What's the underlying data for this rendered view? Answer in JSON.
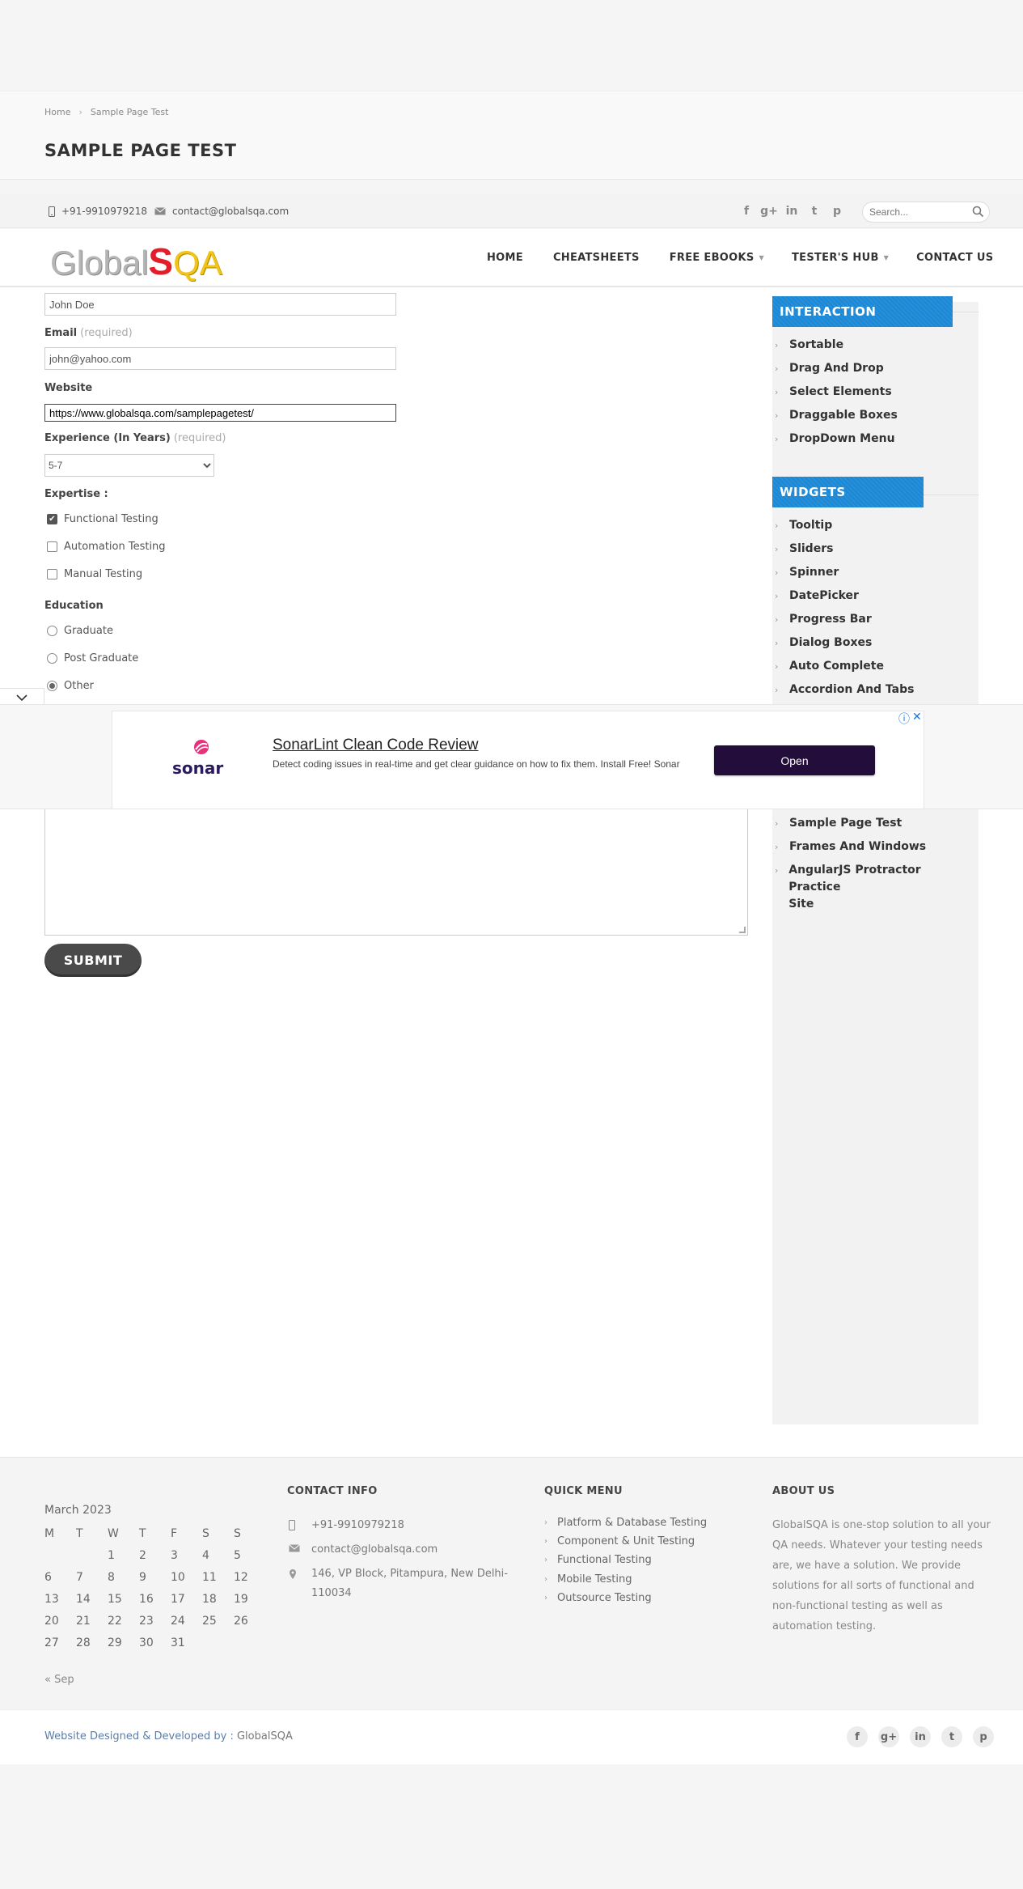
{
  "breadcrumb": {
    "home": "Home",
    "current": "Sample Page Test"
  },
  "page_title": "SAMPLE PAGE TEST",
  "topbar": {
    "phone": "+91-9910979218",
    "email": "contact@globalsqa.com",
    "social": [
      "f",
      "g+",
      "in",
      "t",
      "p"
    ],
    "search_placeholder": "Search..."
  },
  "logo": {
    "part1": "Global",
    "part2": "S",
    "part3": "QA"
  },
  "nav": [
    {
      "label": "HOME",
      "dropdown": false
    },
    {
      "label": "CHEATSHEETS",
      "dropdown": false
    },
    {
      "label": "FREE EBOOKS",
      "dropdown": true
    },
    {
      "label": "TESTER'S HUB",
      "dropdown": true
    },
    {
      "label": "CONTACT US",
      "dropdown": false
    }
  ],
  "form": {
    "name_value": "John Doe",
    "email_label": "Email",
    "email_required": "(required)",
    "email_value": "john@yahoo.com",
    "website_label": "Website",
    "website_value": "https://www.globalsqa.com/samplepagetest/",
    "experience_label": "Experience (In Years)",
    "experience_required": "(required)",
    "experience_value": "5-7",
    "expertise_label": "Expertise :",
    "expertise": [
      {
        "label": "Functional Testing",
        "checked": true
      },
      {
        "label": "Automation Testing",
        "checked": false
      },
      {
        "label": "Manual Testing",
        "checked": false
      }
    ],
    "education_label": "Education",
    "education": [
      {
        "label": "Graduate",
        "selected": false
      },
      {
        "label": "Post Graduate",
        "selected": false
      },
      {
        "label": "Other",
        "selected": true
      }
    ],
    "submit_label": "SUBMIT"
  },
  "sidebar": {
    "interaction_title": "INTERACTION",
    "interaction": [
      "Sortable",
      "Drag And Drop",
      "Select Elements",
      "Draggable Boxes",
      "DropDown Menu"
    ],
    "widgets_title": "WIDGETS",
    "widgets": [
      "Tooltip",
      "Sliders",
      "Spinner",
      "DatePicker",
      "Progress Bar",
      "Dialog Boxes",
      "Auto Complete",
      "Accordion And Tabs"
    ],
    "more": [
      "Sample Page Test",
      "Frames And Windows",
      "AngularJS Protractor Practice",
      "Site"
    ]
  },
  "ad": {
    "brand": "sonar",
    "title": "SonarLint Clean Code Review",
    "description": "Detect coding issues in real-time and get clear guidance on how to fix them. Install Free! Sonar",
    "button": "Open",
    "info_icon": "ⓘ",
    "close_icon": "✕"
  },
  "footer": {
    "calendar": {
      "caption": "March 2023",
      "days": [
        "M",
        "T",
        "W",
        "T",
        "F",
        "S",
        "S"
      ],
      "weeks": [
        [
          "",
          "",
          "1",
          "2",
          "3",
          "4",
          "5"
        ],
        [
          "6",
          "7",
          "8",
          "9",
          "10",
          "11",
          "12"
        ],
        [
          "13",
          "14",
          "15",
          "16",
          "17",
          "18",
          "19"
        ],
        [
          "20",
          "21",
          "22",
          "23",
          "24",
          "25",
          "26"
        ],
        [
          "27",
          "28",
          "29",
          "30",
          "31",
          "",
          ""
        ]
      ],
      "prev": "« Sep"
    },
    "contact_title": "CONTACT INFO",
    "contact": {
      "phone": "+91-9910979218",
      "email": "contact@globalsqa.com",
      "address1": "146, VP Block, Pitampura, New Delhi-",
      "address2": "110034"
    },
    "quick_title": "QUICK MENU",
    "quick": [
      "Platform & Database Testing",
      "Component & Unit Testing",
      "Functional Testing",
      "Mobile Testing",
      "Outsource Testing"
    ],
    "about_title": "ABOUT US",
    "about_text": "GlobalSQA is one-stop solution to all your QA needs. Whatever your testing needs are, we have a solution. We provide solutions for all sorts of functional and non-functional testing as well as automation testing."
  },
  "credit": {
    "prefix": "Website Designed & Developed by : ",
    "name": "GlobalSQA"
  },
  "colors": {
    "accent": "#1b88d6",
    "ad_button": "#230d3a",
    "logo_s": "#e21e2b",
    "logo_qa": "#f0c419"
  }
}
